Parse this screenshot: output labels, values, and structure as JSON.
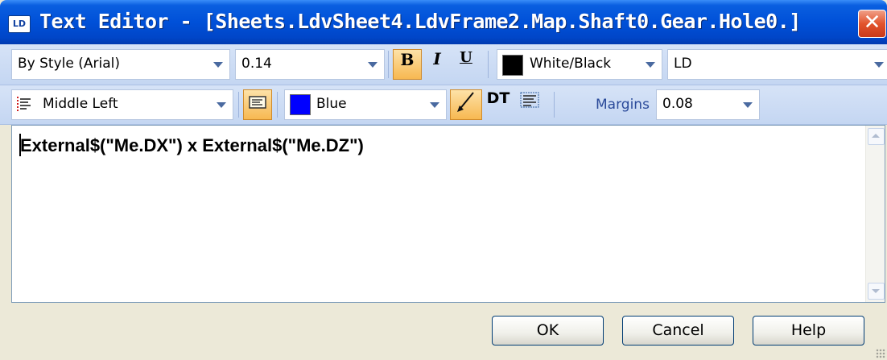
{
  "window": {
    "title": "Text Editor - [Sheets.LdvSheet4.LdvFrame2.Map.Shaft0.Gear.Hole0.]",
    "icon_text": "LD",
    "close_symbol": "✕"
  },
  "toolbar1": {
    "font_value": "By Style (Arial)",
    "size_value": "0.14",
    "bold_label": "B",
    "italic_label": "I",
    "underline_label": "U",
    "color_value": "White/Black",
    "color_swatch": "#000000",
    "layer_value": "LD"
  },
  "toolbar2": {
    "alignment_value": "Middle Left",
    "text_color_value": "Blue",
    "text_color_swatch": "#0000ff",
    "dt_label": "DT",
    "margins_label": "Margins",
    "margins_value": "0.08"
  },
  "editor": {
    "content": "External$(\"Me.DX\") x External$(\"Me.DZ\")"
  },
  "buttons": {
    "ok": "OK",
    "cancel": "Cancel",
    "help": "Help"
  }
}
